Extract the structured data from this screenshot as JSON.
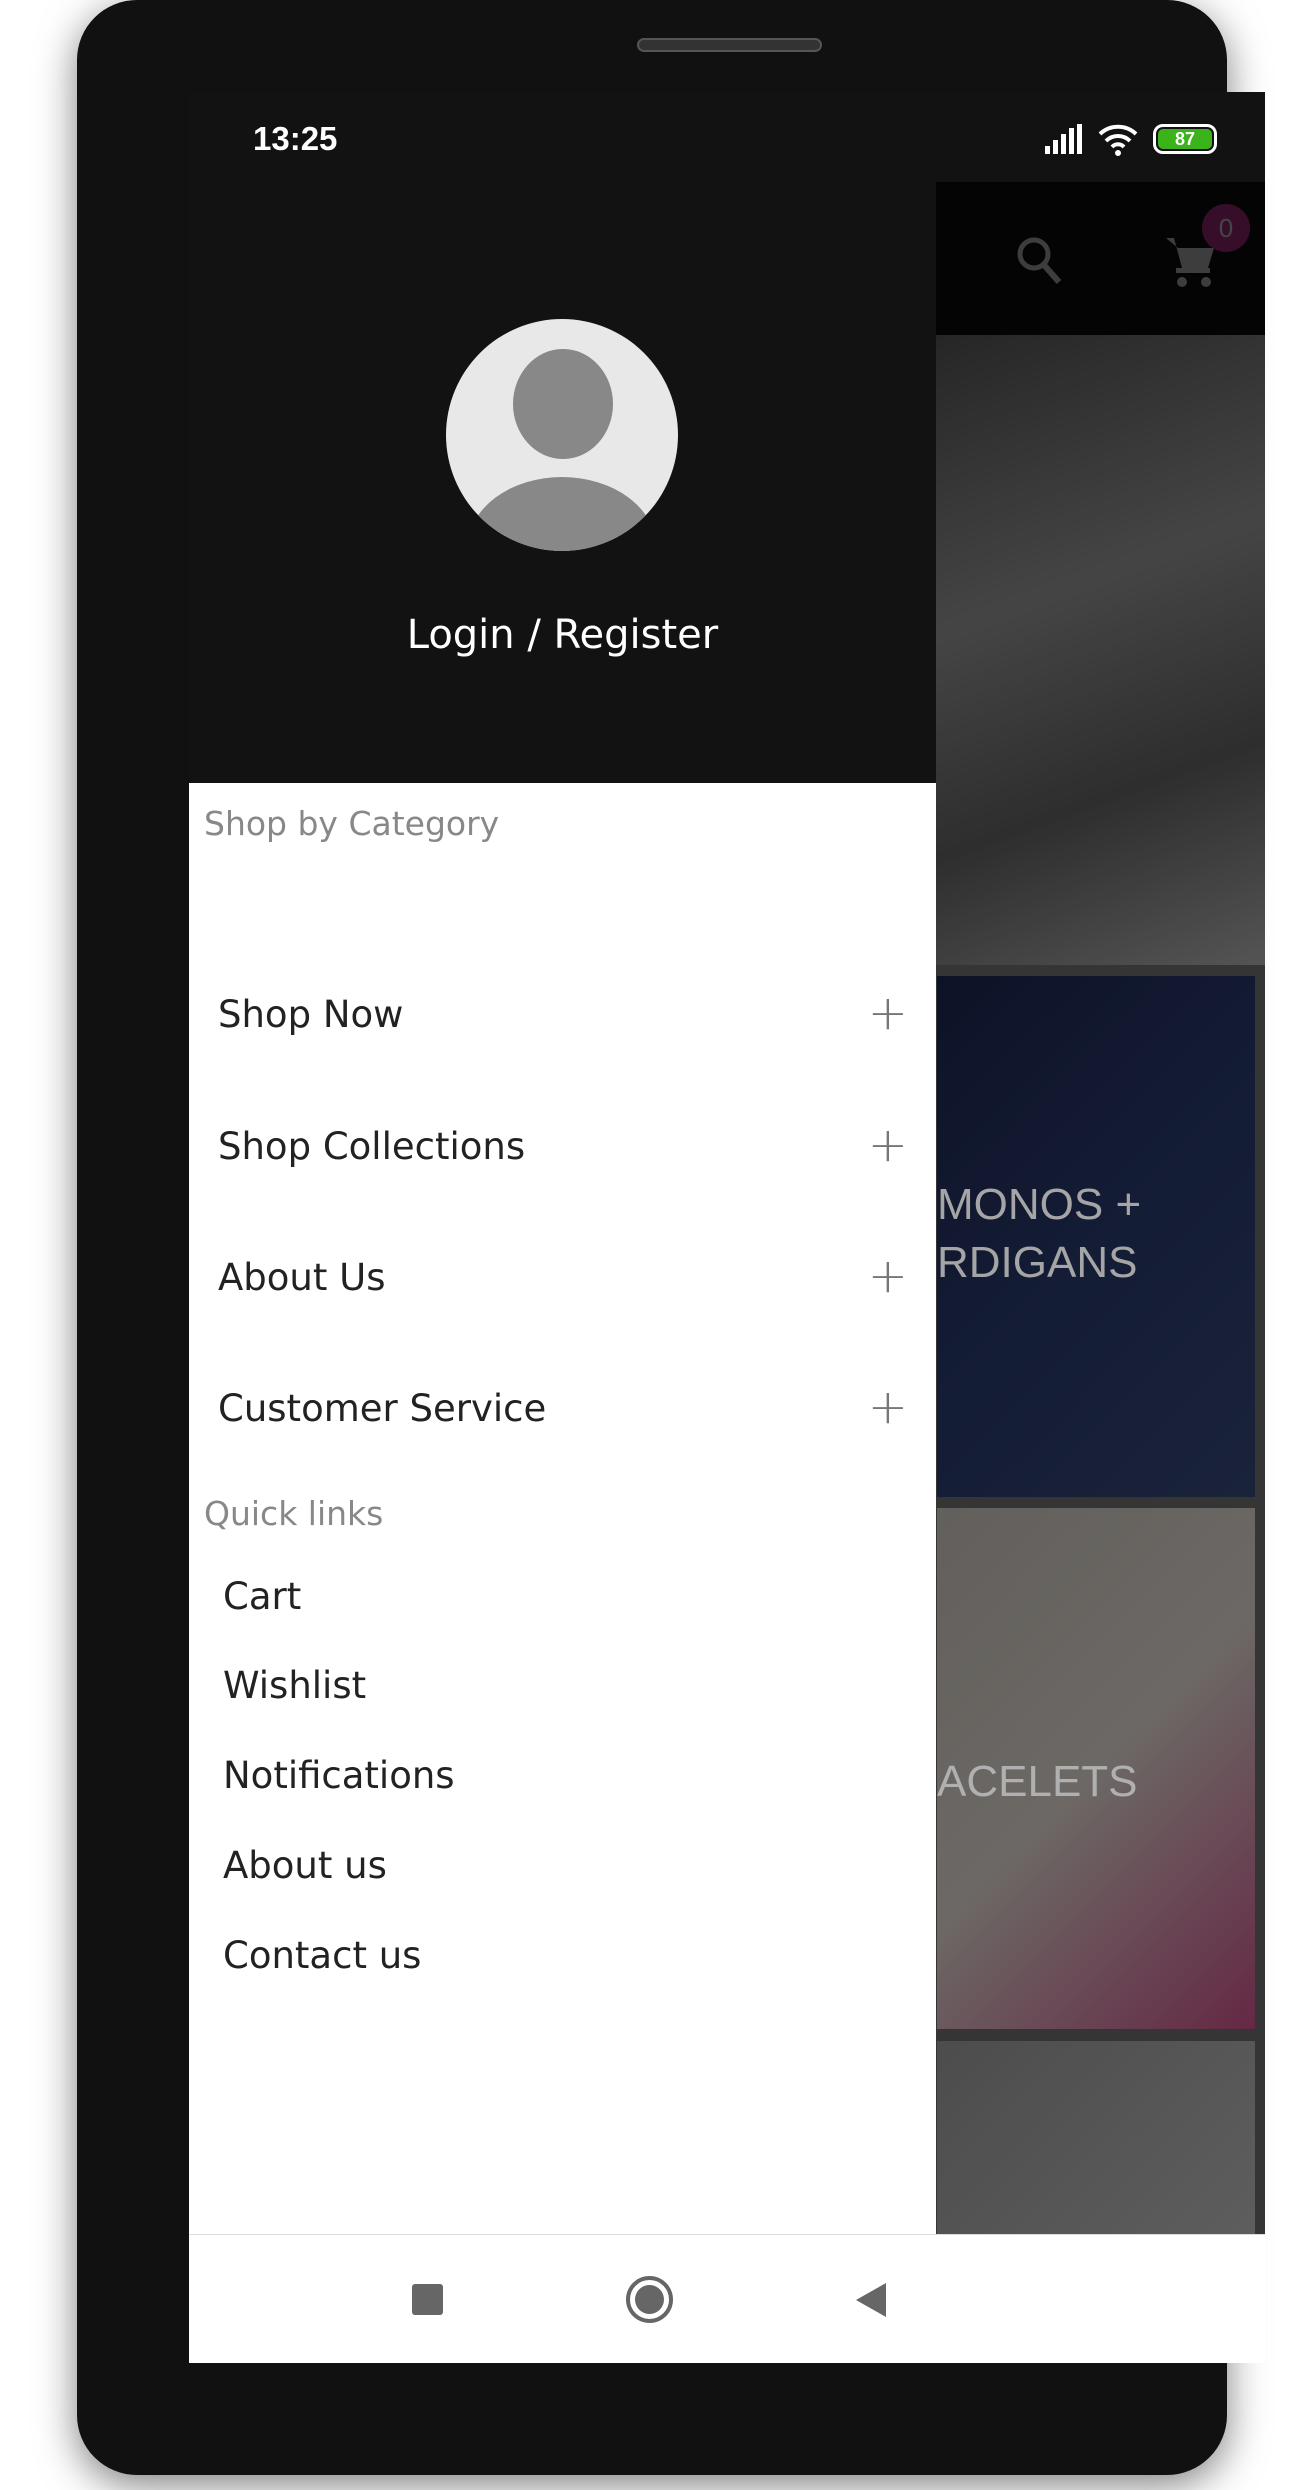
{
  "status_bar": {
    "time": "13:25",
    "battery": "87",
    "icons": [
      "signal-icon",
      "wifi-icon",
      "battery-icon"
    ]
  },
  "app_bar": {
    "icons": [
      "search-icon",
      "cart-icon"
    ],
    "cart_count": "0",
    "badge_color": "#7a1f5c"
  },
  "background_tiles": [
    {
      "label": ""
    },
    {
      "label": "KIMONOS + CARDIGANS",
      "line1": "MONOS +",
      "line2": "RDIGANS"
    },
    {
      "label": "ACELETS"
    },
    {
      "label": ""
    }
  ],
  "drawer": {
    "login_label": "Login / Register",
    "category_heading": "Shop by Category",
    "categories": [
      {
        "label": "Shop Now"
      },
      {
        "label": "Shop Collections"
      },
      {
        "label": "About Us"
      },
      {
        "label": "Customer Service"
      }
    ],
    "expand_symbol": "+",
    "quick_links_heading": "Quick links",
    "quick_links": [
      {
        "label": "Cart"
      },
      {
        "label": "Wishlist"
      },
      {
        "label": "Notifications"
      },
      {
        "label": "About us"
      },
      {
        "label": "Contact us"
      }
    ]
  },
  "nav_bar": {
    "icons": [
      "recents-icon",
      "home-icon",
      "back-icon"
    ]
  }
}
